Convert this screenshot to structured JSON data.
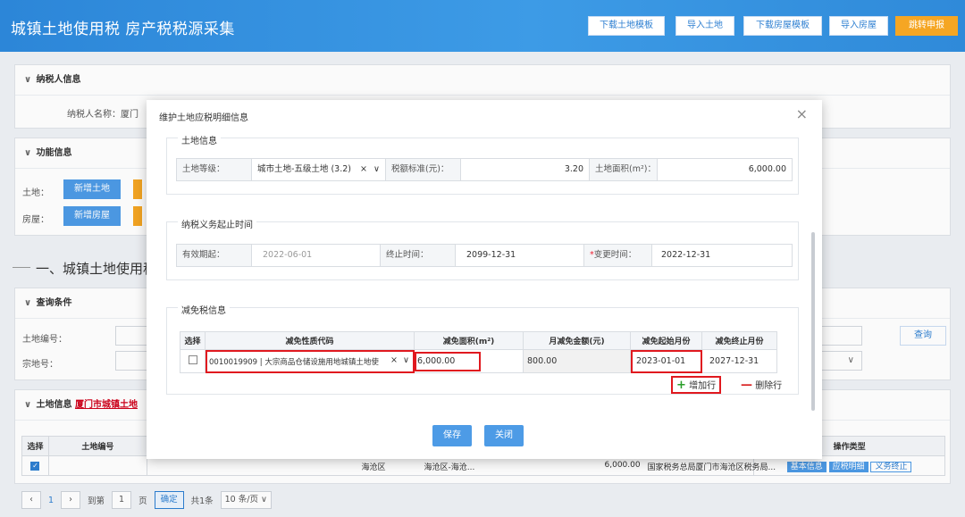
{
  "header": {
    "title": "城镇土地使用税 房产税税源采集",
    "buttons": [
      "下载土地模板",
      "导入土地",
      "下载房屋模板",
      "导入房屋",
      "跳转申报"
    ]
  },
  "bg": {
    "taxpayer_section": "纳税人信息",
    "taxpayer_name_label": "纳税人名称：厦门",
    "function_section": "功能信息",
    "land_label": "土地：",
    "add_land": "新增土地",
    "house_label": "房屋：",
    "add_house": "新增房屋",
    "section_heading": "一、城镇土地使用税",
    "query_section": "查询条件",
    "land_no_label": "土地编号：",
    "parcel_no_label": "宗地号：",
    "query_btn": "查询",
    "land_info_section": "土地信息",
    "land_info_link": "厦门市城镇土地",
    "table": {
      "headers": [
        "选择",
        "土地编号",
        "操作类型"
      ],
      "row": {
        "district": "海沧区",
        "street": "海沧区-海沧...",
        "area": "6,000.00",
        "org": "国家税务总局厦门市海沧区税务局...",
        "actions": [
          "基本信息",
          "应税明细",
          "义务终止"
        ]
      }
    },
    "pager": {
      "current": "1",
      "goto_label": "到第",
      "page_value": "1",
      "page_unit": "页",
      "confirm": "确定",
      "total": "共1条",
      "page_size": "10 条/页"
    }
  },
  "modal": {
    "title": "维护土地应税明细信息",
    "land_info": {
      "legend": "土地信息",
      "grade_label": "土地等级：",
      "grade_value": "城市土地-五级土地 (3.2)",
      "rate_label": "税额标准(元)：",
      "rate_value": "3.20",
      "area_label": "土地面积(m²)：",
      "area_value": "6,000.00"
    },
    "obligation": {
      "legend": "纳税义务起止时间",
      "start_label": "有效期起：",
      "start_value": "2022-06-01",
      "end_label": "终止时间：",
      "end_value": "2099-12-31",
      "change_label": "变更时间：",
      "change_value": "2022-12-31"
    },
    "relief": {
      "legend": "减免税信息",
      "headers": [
        "选择",
        "减免性质代码",
        "减免面积(m²)",
        "月减免金额(元)",
        "减免起始月份",
        "减免终止月份"
      ],
      "row": {
        "code": "0010019909 | 大宗商品仓储设施用地城镇土地使",
        "area": "6,000.00",
        "monthly": "800.00",
        "start": "2023-01-01",
        "end": "2027-12-31"
      },
      "add_row": "增加行",
      "delete_row": "删除行"
    },
    "save": "保存",
    "close": "关闭"
  }
}
